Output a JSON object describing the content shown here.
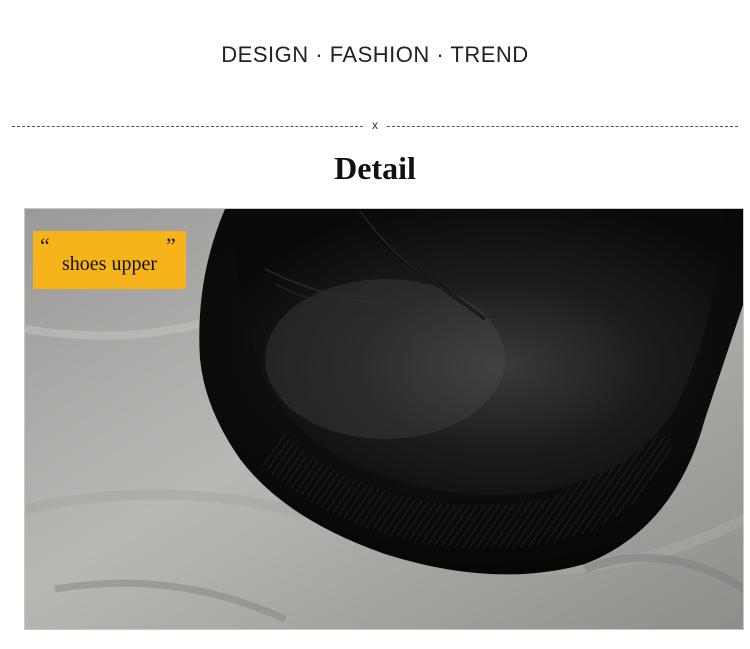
{
  "header": {
    "tagline": "DESIGN · FASHION · TREND",
    "divider_mark": "x"
  },
  "section": {
    "title": "Detail"
  },
  "callout": {
    "open_quote": "“",
    "close_quote": "”",
    "label": "shoes upper",
    "color": "#f6b41a"
  }
}
